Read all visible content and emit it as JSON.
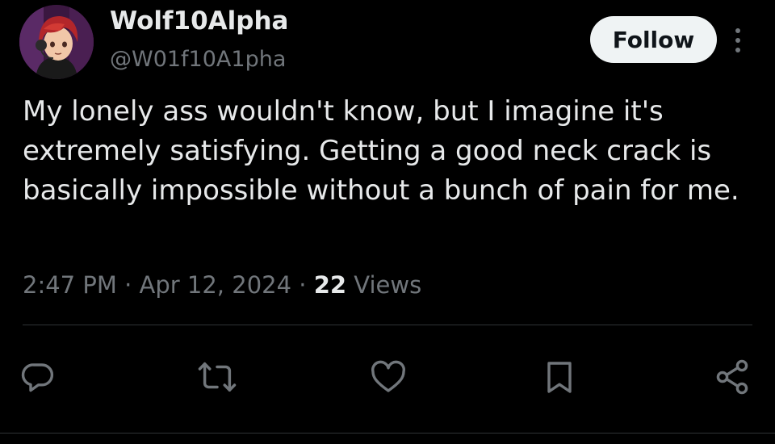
{
  "author": {
    "display_name": "Wolf10Alpha",
    "handle": "@W01f10A1pha",
    "avatar_icon": "anime-character-avatar"
  },
  "follow_label": "Follow",
  "more_icon": "more-vertical-icon",
  "tweet": {
    "text": "My lonely ass wouldn't know, but I imagine it's extremely satisfying. Getting a good neck crack is basically impossible without a bunch of pain for me."
  },
  "meta": {
    "time": "2:47 PM",
    "separator": "·",
    "date": "Apr 12, 2024",
    "views_count": "22",
    "views_label": "Views"
  },
  "actions": [
    {
      "icon": "reply-icon"
    },
    {
      "icon": "retweet-icon"
    },
    {
      "icon": "like-icon"
    },
    {
      "icon": "bookmark-icon"
    },
    {
      "icon": "share-icon"
    }
  ],
  "colors": {
    "background": "#000000",
    "primary_text": "#e7e9ea",
    "secondary_text": "#71767b",
    "divider": "#2f3336",
    "follow_button_bg": "#eff3f4",
    "follow_button_text": "#0f1419"
  }
}
